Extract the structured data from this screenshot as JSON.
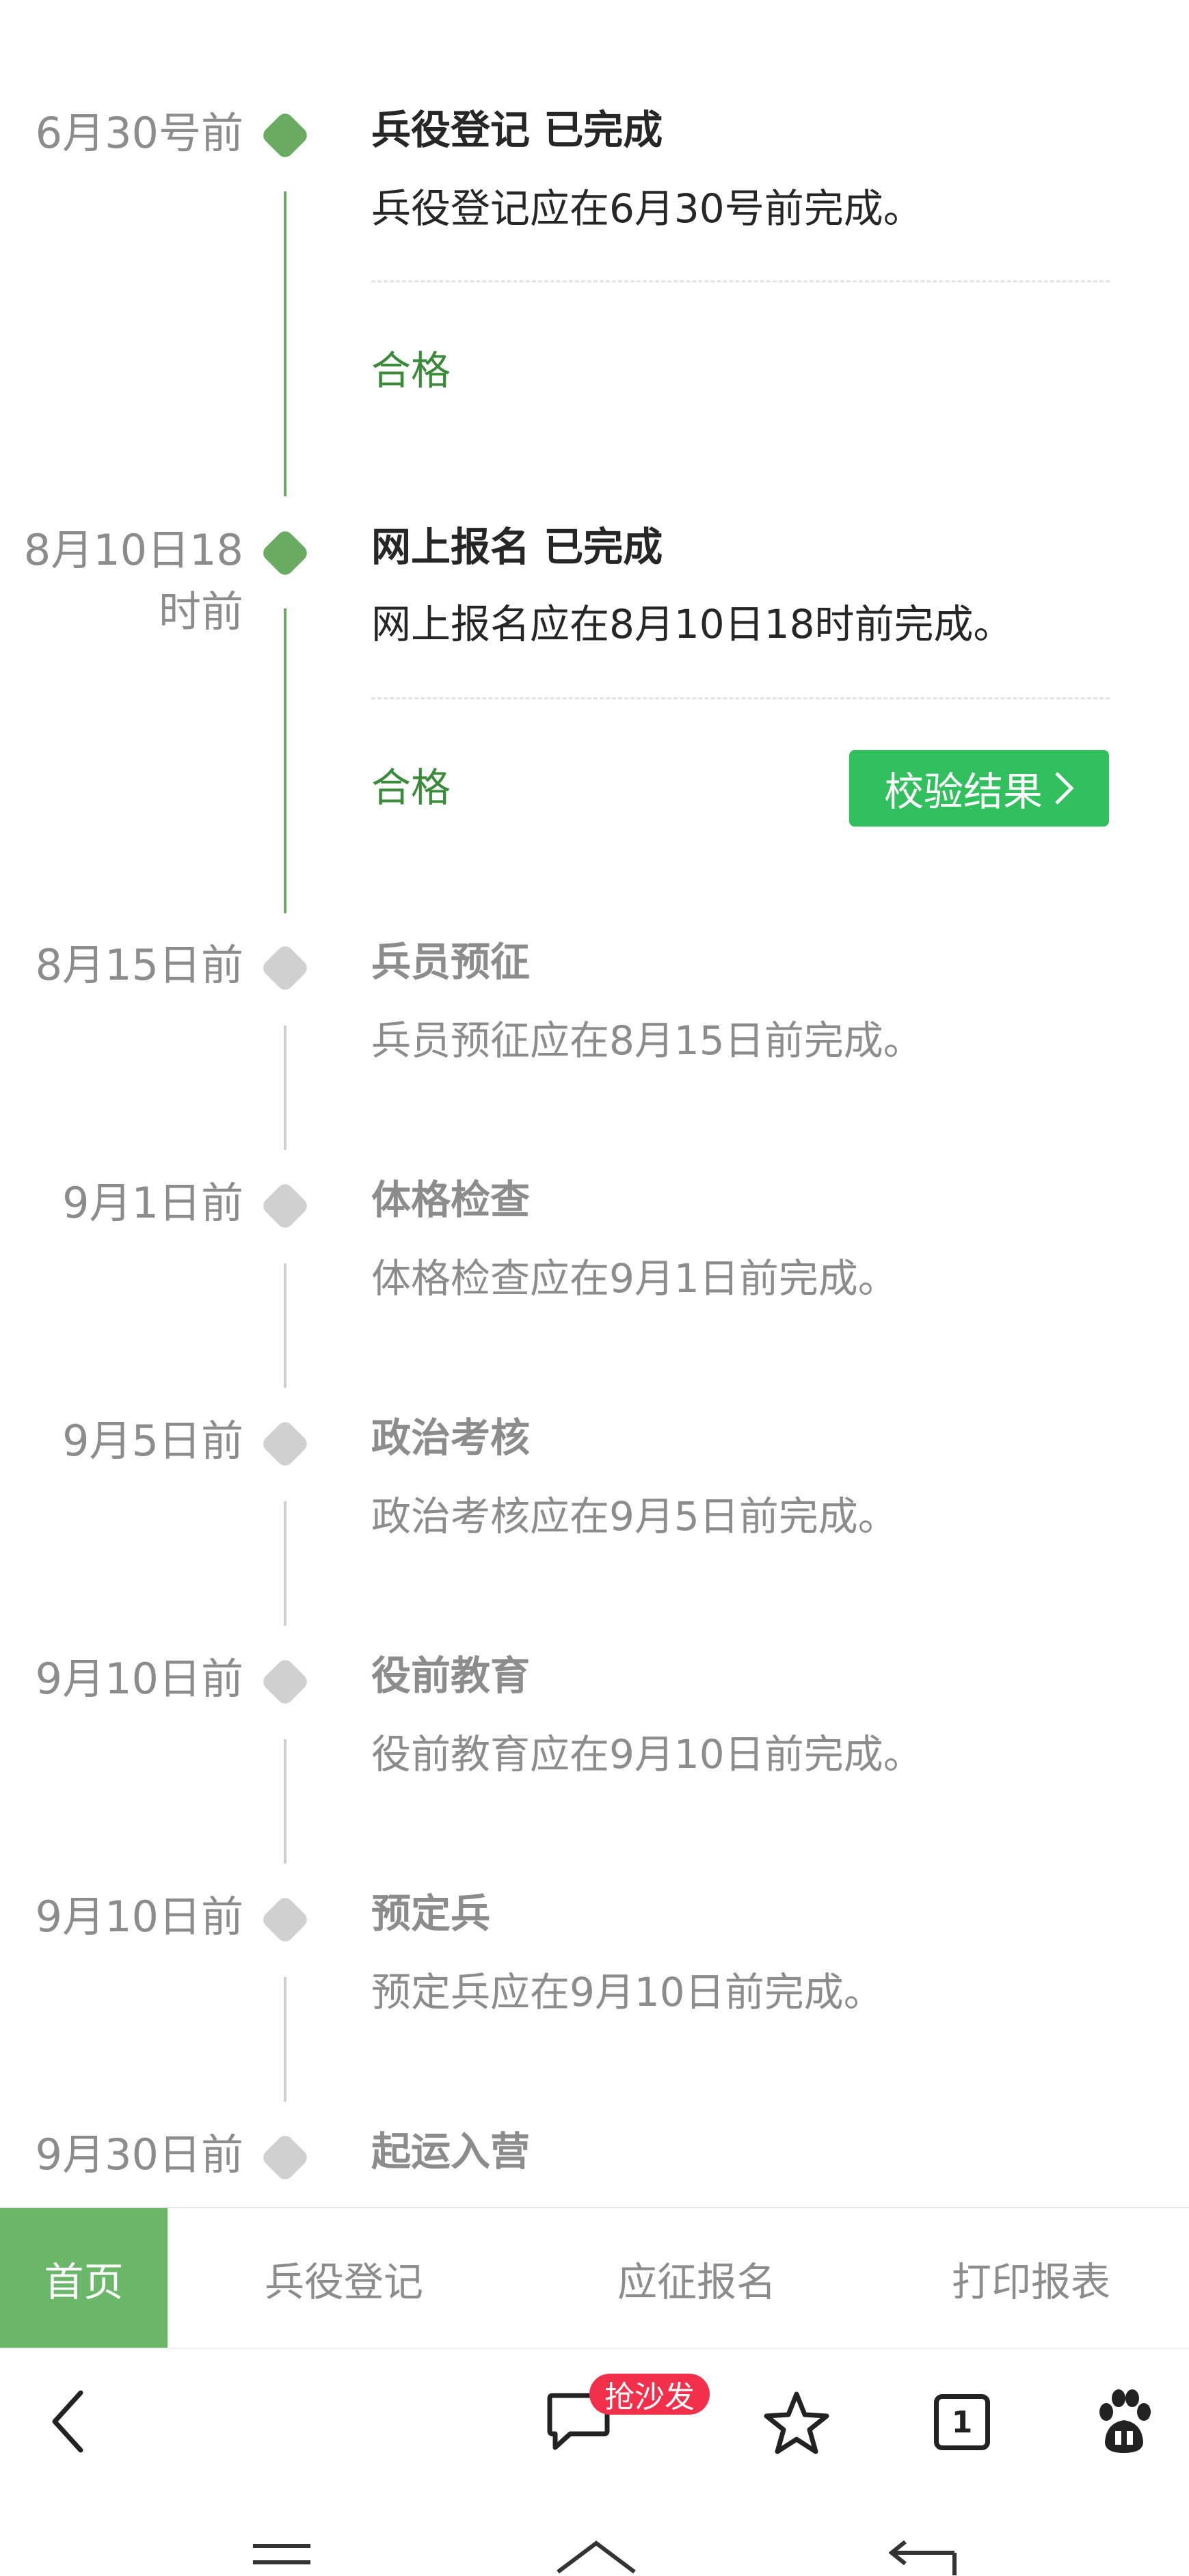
{
  "timeline": [
    {
      "date": "6月30号前",
      "title": "兵役登记 已完成",
      "desc": "兵役登记应在6月30号前完成。",
      "result": "合格",
      "status": "done"
    },
    {
      "date": "8月10日18时前",
      "title": "网上报名 已完成",
      "desc": "网上报名应在8月10日18时前完成。",
      "result": "合格",
      "button": "校验结果",
      "status": "done"
    },
    {
      "date": "8月15日前",
      "title": "兵员预征",
      "desc": "兵员预征应在8月15日前完成。",
      "status": "pending"
    },
    {
      "date": "9月1日前",
      "title": "体格检查",
      "desc": "体格检查应在9月1日前完成。",
      "status": "pending"
    },
    {
      "date": "9月5日前",
      "title": "政治考核",
      "desc": "政治考核应在9月5日前完成。",
      "status": "pending"
    },
    {
      "date": "9月10日前",
      "title": "役前教育",
      "desc": "役前教育应在9月10日前完成。",
      "status": "pending"
    },
    {
      "date": "9月10日前",
      "title": "预定兵",
      "desc": "预定兵应在9月10日前完成。",
      "status": "pending"
    },
    {
      "date": "9月30日前",
      "title": "起运入营",
      "status": "pending"
    }
  ],
  "tabs": [
    "首页",
    "兵役登记",
    "应征报名",
    "打印报表"
  ],
  "browser": {
    "badge": "抢沙发",
    "tab_count": "1"
  },
  "colors": {
    "done": "#6aab62",
    "pending": "#d0d0d0",
    "active_tab": "#6ab76a",
    "button": "#31c05d",
    "badge": "#f2304b"
  }
}
